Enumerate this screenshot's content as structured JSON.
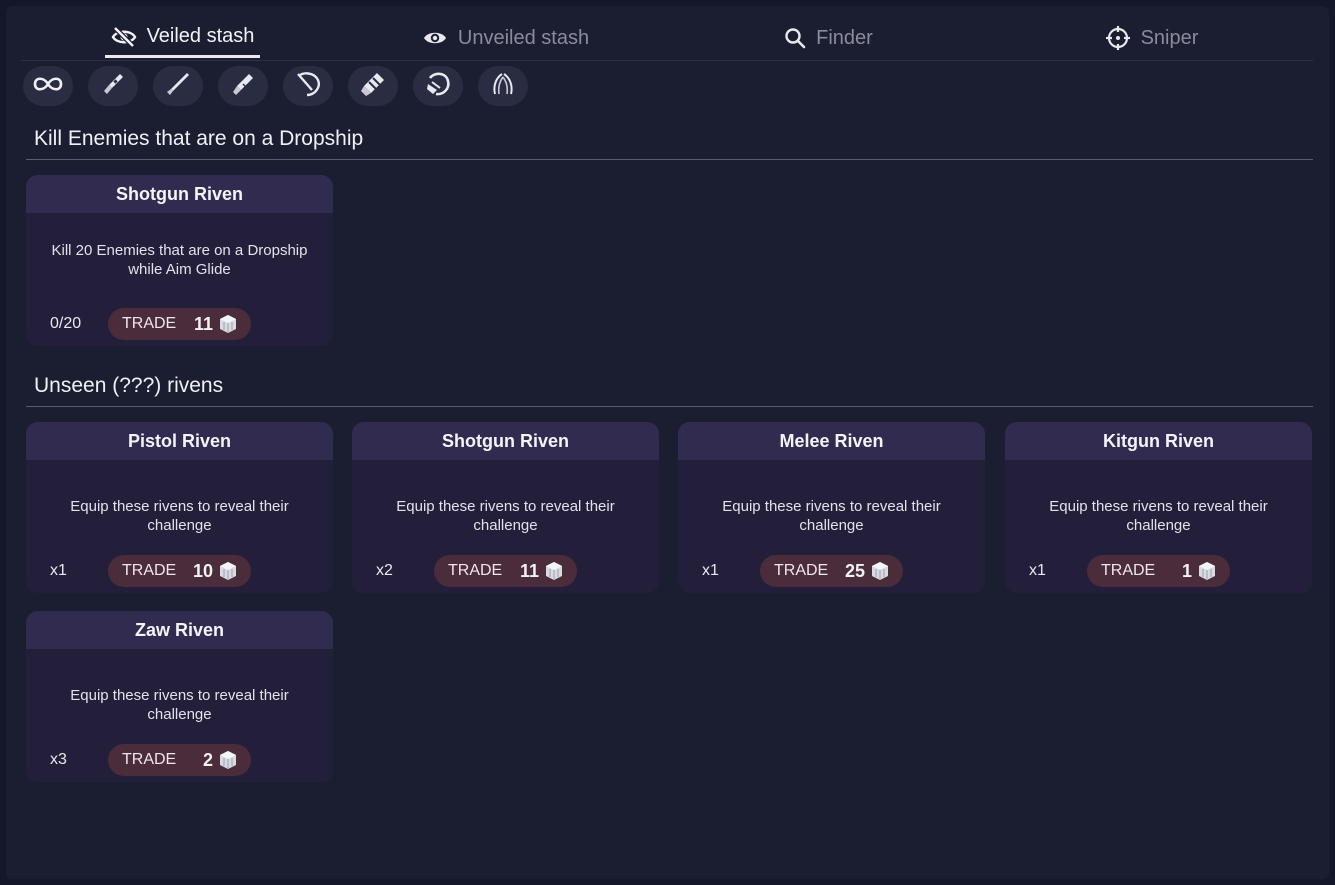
{
  "tabs": [
    {
      "label": "Veiled stash",
      "icon": "eye-slash-icon",
      "active": true
    },
    {
      "label": "Unveiled stash",
      "icon": "eye-icon",
      "active": false
    },
    {
      "label": "Finder",
      "icon": "search-icon",
      "active": false
    },
    {
      "label": "Sniper",
      "icon": "crosshair-icon",
      "active": false
    }
  ],
  "filters": [
    {
      "icon": "infinity-icon"
    },
    {
      "icon": "pistol-icon"
    },
    {
      "icon": "rifle-icon"
    },
    {
      "icon": "shotgun-icon"
    },
    {
      "icon": "melee-icon"
    },
    {
      "icon": "kitgun-icon"
    },
    {
      "icon": "zaw-icon"
    },
    {
      "icon": "archgun-icon"
    }
  ],
  "sections": [
    {
      "title": "Kill Enemies that are on a Dropship",
      "cards": [
        {
          "title": "Shotgun Riven",
          "desc": "Kill 20 Enemies that are on a Dropship while Aim Glide",
          "qty": "0/20",
          "trade": "TRADE",
          "price": "11"
        }
      ]
    },
    {
      "title": "Unseen (???) rivens",
      "cards": [
        {
          "title": "Pistol Riven",
          "desc": "Equip these rivens to reveal their challenge",
          "qty": "x1",
          "trade": "TRADE",
          "price": "10"
        },
        {
          "title": "Shotgun Riven",
          "desc": "Equip these rivens to reveal their challenge",
          "qty": "x2",
          "trade": "TRADE",
          "price": "11"
        },
        {
          "title": "Melee Riven",
          "desc": "Equip these rivens to reveal their challenge",
          "qty": "x1",
          "trade": "TRADE",
          "price": "25"
        },
        {
          "title": "Kitgun Riven",
          "desc": "Equip these rivens to reveal their challenge",
          "qty": "x1",
          "trade": "TRADE",
          "price": "1"
        },
        {
          "title": "Zaw Riven",
          "desc": "Equip these rivens to reveal their challenge",
          "qty": "x3",
          "trade": "TRADE",
          "price": "2"
        }
      ]
    }
  ],
  "colors": {
    "background": "#1b1e30",
    "card": "#231f3a",
    "card_header": "#322b50",
    "trade_pill": "#4a2c3b"
  }
}
